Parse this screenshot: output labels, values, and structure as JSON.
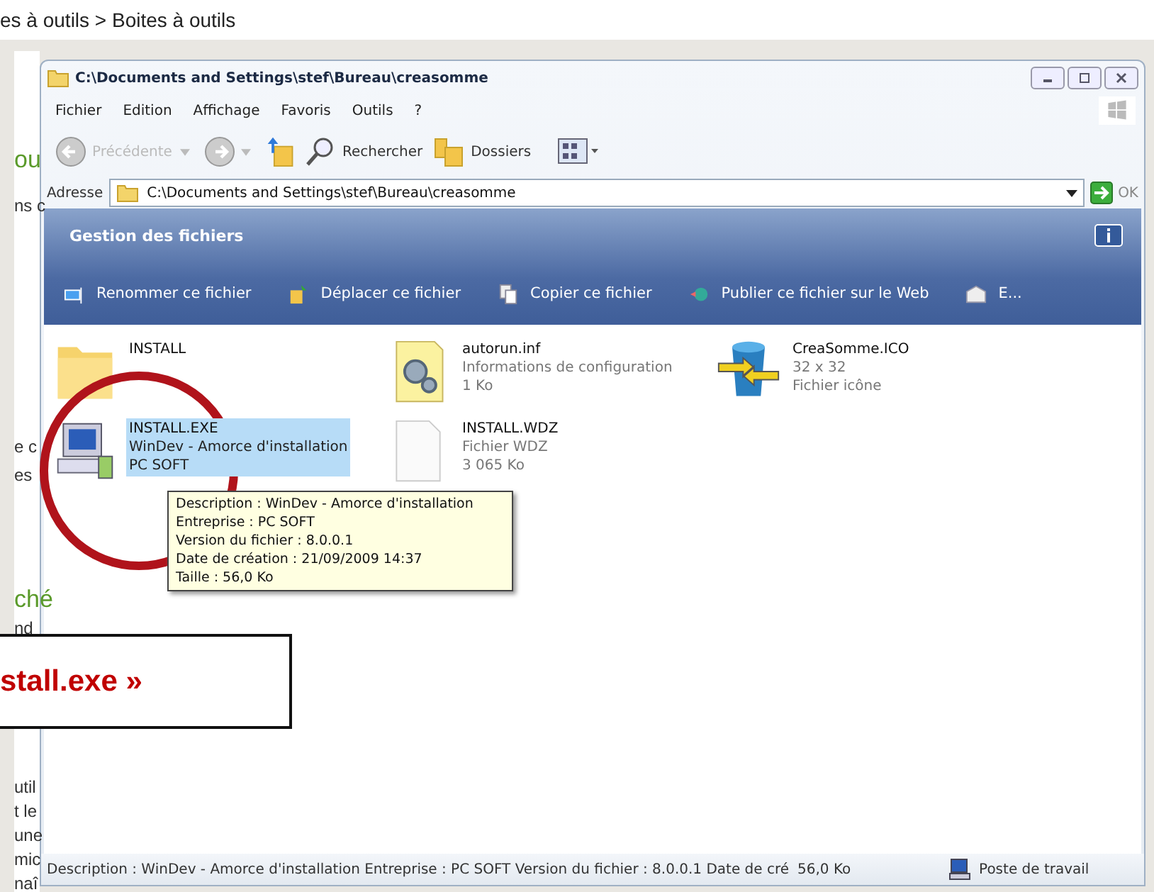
{
  "breadcrumb": "es à outils > Boites à outils",
  "background_fragments": [
    {
      "text": "ou",
      "kind": "heading"
    },
    {
      "text": "ns c",
      "kind": "text"
    },
    {
      "text": "e c",
      "kind": "text"
    },
    {
      "text": "es",
      "kind": "text"
    },
    {
      "text": "ché",
      "kind": "heading"
    },
    {
      "text": "nd",
      "kind": "text"
    },
    {
      "text": "util",
      "kind": "text"
    },
    {
      "text": "t le",
      "kind": "text"
    },
    {
      "text": "une",
      "kind": "text"
    },
    {
      "text": "mic",
      "kind": "text"
    },
    {
      "text": "naî",
      "kind": "text"
    }
  ],
  "window": {
    "title": "C:\\Documents and Settings\\stef\\Bureau\\creasomme"
  },
  "menu": [
    "Fichier",
    "Edition",
    "Affichage",
    "Favoris",
    "Outils",
    "?"
  ],
  "toolbar": {
    "back": {
      "label": "Précédente",
      "disabled": true
    },
    "search": "Rechercher",
    "folders": "Dossiers"
  },
  "address": {
    "label": "Adresse",
    "value": "C:\\Documents and Settings\\stef\\Bureau\\creasomme",
    "go": "OK"
  },
  "panel": {
    "title": "Gestion des fichiers",
    "tasks": [
      {
        "label": "Renommer ce fichier",
        "kind": "rename"
      },
      {
        "label": "Déplacer ce fichier",
        "kind": "move"
      },
      {
        "label": "Copier ce fichier",
        "kind": "copy"
      },
      {
        "label": "Publier ce fichier sur le Web",
        "kind": "web"
      },
      {
        "label": "E...",
        "kind": "mail"
      }
    ]
  },
  "files": [
    {
      "kind": "folder",
      "name": "INSTALL",
      "selected": false
    },
    {
      "kind": "inf",
      "name": "autorun.inf",
      "details": [
        "Informations de configuration",
        "1 Ko"
      ],
      "selected": false
    },
    {
      "kind": "ico",
      "name": "CreaSomme.ICO",
      "details": [
        "32 x 32",
        "Fichier icône"
      ],
      "selected": false
    },
    {
      "kind": "exe",
      "name": "INSTALL.EXE",
      "details": [
        "WinDev - Amorce d'installation",
        "PC SOFT"
      ],
      "selected": true
    },
    {
      "kind": "blank",
      "name": "INSTALL.WDZ",
      "details": [
        "Fichier WDZ",
        "3 065 Ko"
      ],
      "selected": false
    }
  ],
  "tooltip": [
    "Description : WinDev - Amorce d'installation",
    "Entreprise : PC SOFT",
    "Version du fichier : 8.0.0.1",
    "Date de création : 21/09/2009 14:37",
    "Taille  : 56,0 Ko"
  ],
  "status_bar": {
    "description": "Description : WinDev - Amorce d'installation Entreprise : PC SOFT Version du fichier : 8.0.0.1 Date de cré",
    "size": "56,0 Ko",
    "zone": "Poste de travail"
  },
  "callout": "stall.exe »"
}
